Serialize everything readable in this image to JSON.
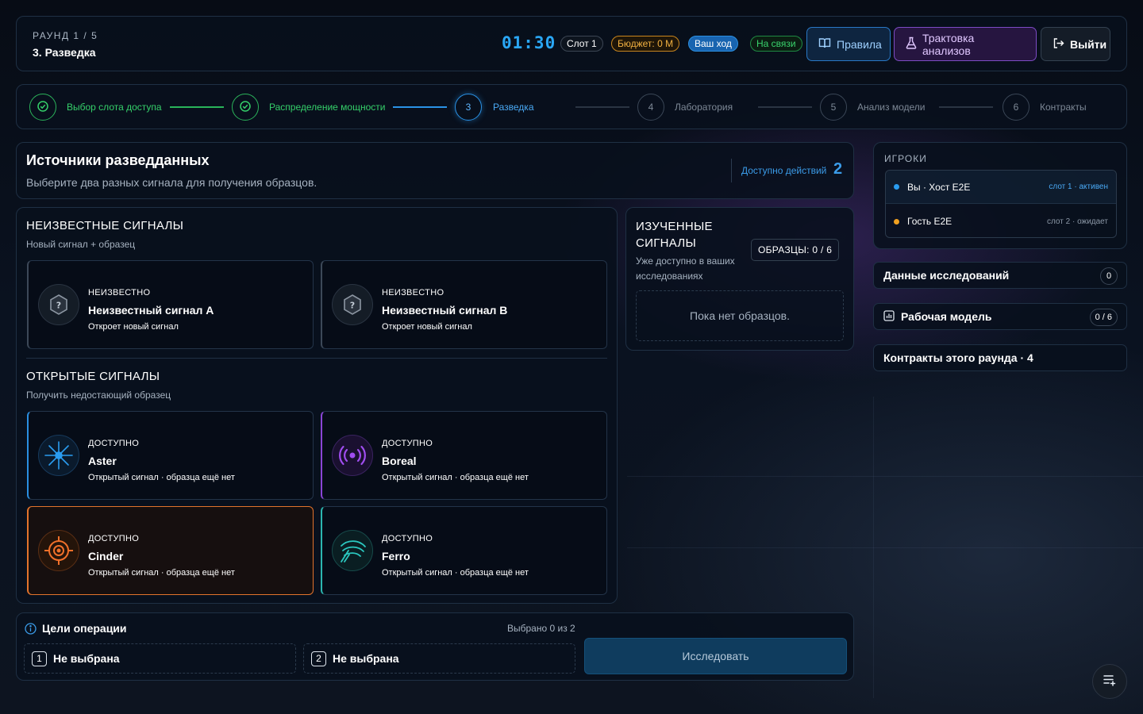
{
  "header": {
    "round": "РАУНД 1 / 5",
    "stage": "3. Разведка",
    "timer": "01:30",
    "slot": "Слот 1",
    "budget": "Бюджет: 0 M",
    "turn": "Ваш ход",
    "online": "На связи",
    "rules_label": "Правила",
    "analysis_label": "Трактовка анализов",
    "exit_label": "Выйти"
  },
  "stepper": {
    "steps": [
      {
        "num": "1",
        "label": "Выбор слота доступа",
        "state": "done"
      },
      {
        "num": "2",
        "label": "Распределение мощности",
        "state": "done"
      },
      {
        "num": "3",
        "label": "Разведка",
        "state": "active"
      },
      {
        "num": "4",
        "label": "Лаборатория",
        "state": "pending"
      },
      {
        "num": "5",
        "label": "Анализ модели",
        "state": "pending"
      },
      {
        "num": "6",
        "label": "Контракты",
        "state": "pending"
      }
    ]
  },
  "sources": {
    "title": "Источники разведданных",
    "description": "Выберите два разных сигнала для получения образцов.",
    "actions_label": "Доступно действий",
    "actions_count": "2"
  },
  "unknown": {
    "title": "НЕИЗВЕСТНЫЕ СИГНАЛЫ",
    "subtitle": "Новый сигнал + образец",
    "cards": [
      {
        "status": "НЕИЗВЕСТНО",
        "name": "Неизвестный сигнал A",
        "desc": "Откроет новый сигнал"
      },
      {
        "status": "НЕИЗВЕСТНО",
        "name": "Неизвестный сигнал B",
        "desc": "Откроет новый сигнал"
      }
    ]
  },
  "open": {
    "title": "ОТКРЫТЫЕ СИГНАЛЫ",
    "subtitle": "Получить недостающий образец",
    "cards": [
      {
        "status": "ДОСТУПНО",
        "name": "Aster",
        "desc": "Открытый сигнал · образца ещё нет",
        "icon": "starburst-icon",
        "color": "#2a9cf0"
      },
      {
        "status": "ДОСТУПНО",
        "name": "Boreal",
        "desc": "Открытый сигнал · образца ещё нет",
        "icon": "broadcast-icon",
        "color": "#a04df0"
      },
      {
        "status": "ДОСТУПНО",
        "name": "Cinder",
        "desc": "Открытый сигнал · образца ещё нет",
        "icon": "target-icon",
        "color": "#f0702a"
      },
      {
        "status": "ДОСТУПНО",
        "name": "Ferro",
        "desc": "Открытый сигнал · образца ещё нет",
        "icon": "wave-icon",
        "color": "#2bc8c0"
      }
    ]
  },
  "studied": {
    "title": "ИЗУЧЕННЫЕ СИГНАЛЫ",
    "subtitle": "Уже доступно в ваших исследованиях",
    "samples": "ОБРАЗЦЫ: 0 / 6",
    "empty": "Пока нет образцов."
  },
  "goals": {
    "title": "Цели операции",
    "count": "Выбрано 0 из 2",
    "slots": [
      {
        "num": "1",
        "label": "Не выбрана"
      },
      {
        "num": "2",
        "label": "Не выбрана"
      }
    ],
    "investigate_label": "Исследовать"
  },
  "players": {
    "title": "ИГРОКИ",
    "list": [
      {
        "name": "Вы · Хост E2E",
        "slot": "слот 1 · активен",
        "color": "#2a9cf0"
      },
      {
        "name": "Гость E2E",
        "slot": "слот 2 · ожидает",
        "color": "#f0a020"
      }
    ]
  },
  "sidebar": {
    "research_label": "Данные исследований",
    "research_count": "0",
    "model_label": "Рабочая модель",
    "model_count": "0 / 6",
    "contracts_label": "Контракты этого раунда · 4"
  }
}
